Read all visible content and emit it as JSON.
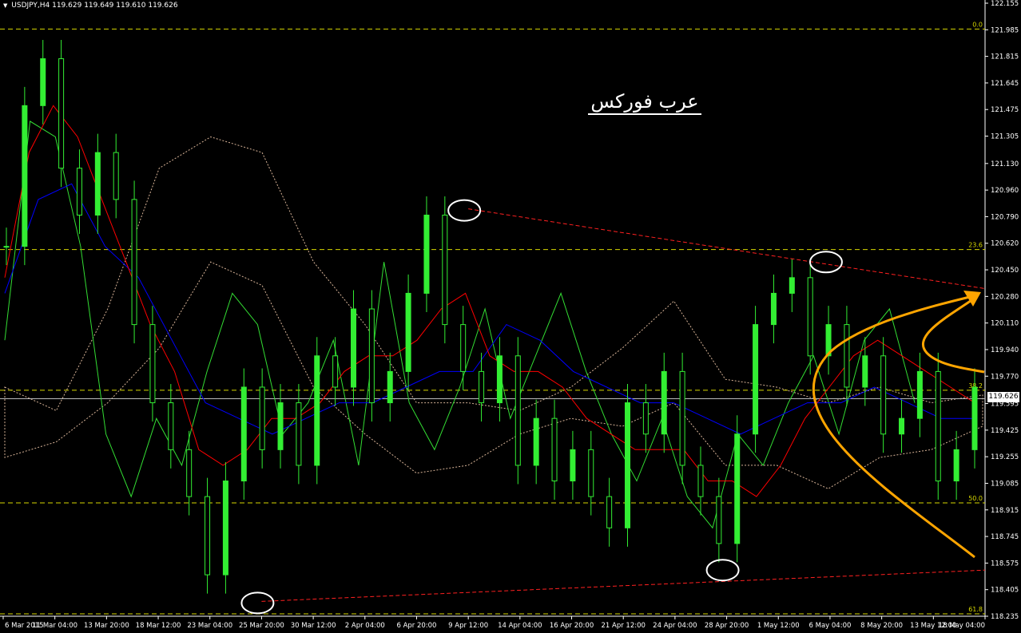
{
  "header": {
    "symbol": "USDJPY,H4",
    "ohlc": "119.629 119.649 119.610 119.626"
  },
  "watermark": "عرب فوركس",
  "current_price": "119.626",
  "colors": {
    "background": "#000000",
    "candles": "#33ee33",
    "chikou": "#33dd33",
    "kijun": "#0000ff",
    "tenkan": "#ff0000",
    "kumo": "#f0c8a8",
    "fib": "#d8d800",
    "trendline": "#ff2020",
    "arrow": "#ffa500",
    "circle": "#ffffff"
  },
  "chart_data": {
    "type": "candlestick",
    "ylim": [
      118.235,
      122.155
    ],
    "y_ticks": [
      "122.155",
      "121.985",
      "121.815",
      "121.645",
      "121.475",
      "121.305",
      "121.130",
      "120.960",
      "120.790",
      "120.620",
      "120.450",
      "120.280",
      "120.110",
      "119.940",
      "119.770",
      "119.595",
      "119.425",
      "119.255",
      "119.085",
      "118.915",
      "118.745",
      "118.575",
      "118.405",
      "118.235"
    ],
    "x_ticks": [
      "6 Mar 2015",
      "11 Mar 04:00",
      "13 Mar 20:00",
      "18 Mar 12:00",
      "23 Mar 04:00",
      "25 Mar 20:00",
      "30 Mar 12:00",
      "2 Apr 04:00",
      "6 Apr 20:00",
      "9 Apr 12:00",
      "14 Apr 04:00",
      "16 Apr 20:00",
      "21 Apr 12:00",
      "24 Apr 04:00",
      "28 Apr 20:00",
      "1 May 12:00",
      "6 May 04:00",
      "8 May 20:00",
      "13 May 12:00",
      "18 May 04:00"
    ],
    "current_price": 119.626,
    "fibonacci": [
      {
        "label": "0.0",
        "value": 121.99
      },
      {
        "label": "23.6",
        "value": 120.58
      },
      {
        "label": "38.2",
        "value": 119.68
      },
      {
        "label": "50.0",
        "value": 118.96
      },
      {
        "label": "61.8",
        "value": 118.25
      }
    ],
    "trendlines": [
      {
        "from": [
          "9 Apr 12:00",
          120.84
        ],
        "to": [
          "18 May 04:00",
          120.33
        ]
      },
      {
        "from": [
          "25 Mar 20:00",
          118.33
        ],
        "to": [
          "18 May 04:00",
          118.53
        ]
      }
    ],
    "series": [
      {
        "name": "price",
        "close": [
          120.6,
          121.5,
          121.8,
          121.1,
          120.8,
          121.2,
          120.9,
          120.1,
          119.6,
          119.3,
          119.0,
          118.5,
          119.1,
          119.7,
          119.3,
          119.6,
          119.2,
          119.9,
          119.7,
          120.2,
          119.6,
          119.8,
          120.3,
          120.8,
          120.1,
          119.8,
          119.6,
          119.9,
          119.2,
          119.5,
          119.1,
          119.3,
          119.0,
          118.8,
          119.6,
          119.4,
          119.8,
          119.2,
          119.0,
          118.7,
          119.4,
          120.1,
          120.3,
          120.4,
          119.9,
          120.1,
          119.7,
          119.9,
          119.4,
          119.5,
          119.8,
          119.1,
          119.3,
          119.7
        ]
      },
      {
        "name": "tenkan",
        "values": [
          120.4,
          121.2,
          121.5,
          121.3,
          120.9,
          120.5,
          120.1,
          119.8,
          119.3,
          119.2,
          119.3,
          119.5,
          119.5,
          119.6,
          119.8,
          119.9,
          119.9,
          120.0,
          120.2,
          120.3,
          119.9,
          119.8,
          119.8,
          119.7,
          119.5,
          119.4,
          119.3,
          119.3,
          119.3,
          119.1,
          119.1,
          119.0,
          119.2,
          119.5,
          119.7,
          119.9,
          120.0,
          119.9,
          119.8,
          119.7,
          119.6
        ]
      },
      {
        "name": "kijun",
        "values": [
          120.3,
          120.9,
          121.0,
          120.6,
          120.4,
          120.0,
          119.6,
          119.5,
          119.4,
          119.5,
          119.6,
          119.6,
          119.7,
          119.8,
          119.8,
          120.1,
          120.0,
          119.8,
          119.7,
          119.6,
          119.6,
          119.5,
          119.4,
          119.5,
          119.6,
          119.6,
          119.7,
          119.6,
          119.5,
          119.5
        ]
      }
    ]
  }
}
